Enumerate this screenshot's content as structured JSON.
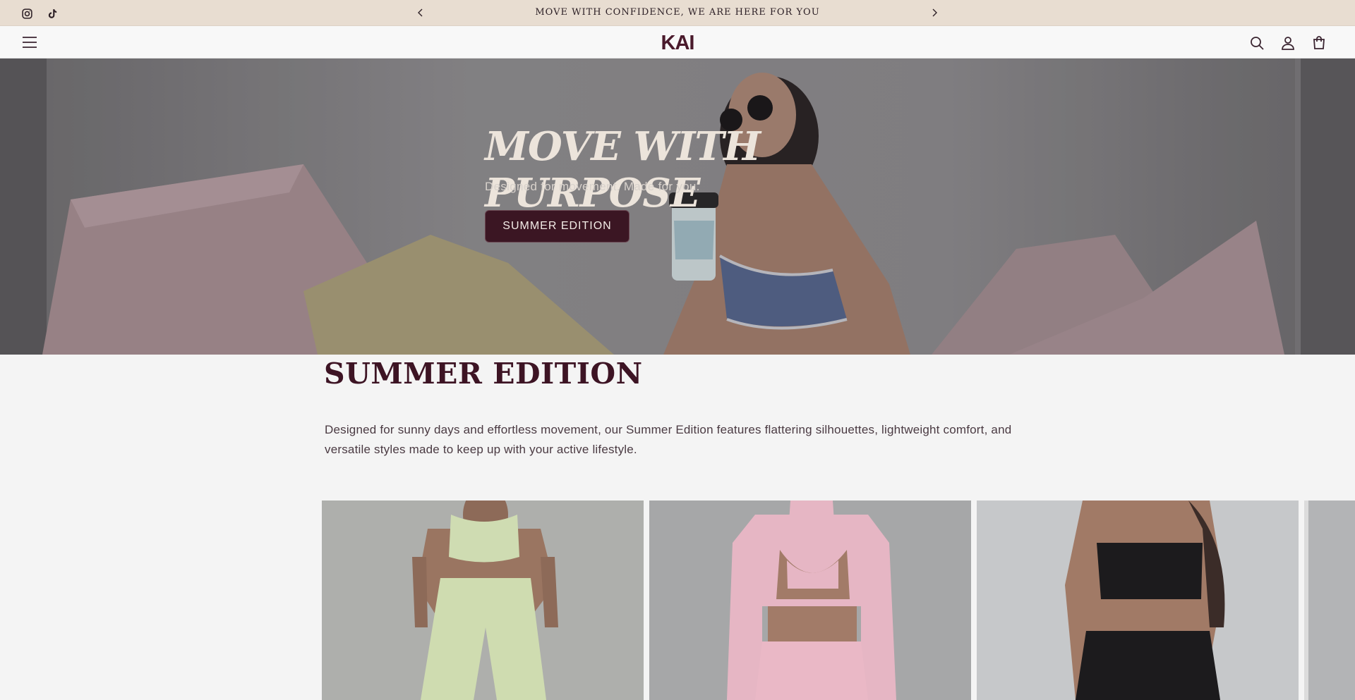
{
  "announcement": {
    "text": "MOVE WITH CONFIDENCE, WE ARE HERE FOR YOU",
    "social": [
      "instagram-icon",
      "tiktok-icon"
    ],
    "prev_icon": "chevron-left-icon",
    "next_icon": "chevron-right-icon"
  },
  "header": {
    "logo_text": "KAI",
    "menu_icon": "hamburger-menu-icon",
    "icons": [
      "search-icon",
      "account-icon",
      "cart-icon"
    ]
  },
  "hero": {
    "title": "MOVE WITH PURPOSE",
    "subtitle": "Designed for movement. Made for you.",
    "button_label": "SUMMER EDITION"
  },
  "collection": {
    "title": "SUMMER EDITION",
    "description": "Designed for sunny days and effortless movement, our Summer Edition features flattering silhouettes, lightweight comfort, and versatile styles made to keep up with your active lifestyle."
  },
  "colors": {
    "announcement_bg": "#e8ddd1",
    "brand": "#3b1623",
    "hero_title": "#ece4db",
    "page_bg": "#f4f4f4"
  }
}
